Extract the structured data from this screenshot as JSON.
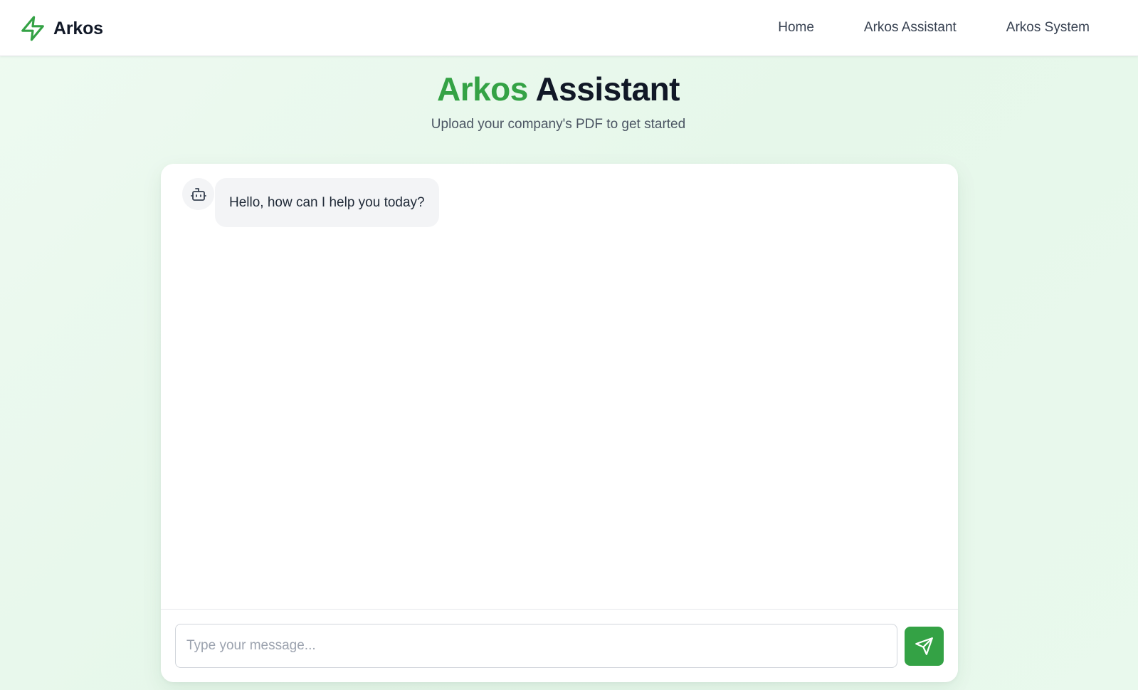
{
  "header": {
    "brand": {
      "icon": "lightning-bolt-icon",
      "name": "Arkos"
    },
    "nav": [
      {
        "label": "Home"
      },
      {
        "label": "Arkos Assistant"
      },
      {
        "label": "Arkos System"
      }
    ]
  },
  "hero": {
    "title_accent": "Arkos",
    "title_main": "Assistant",
    "subtitle": "Upload your company's PDF to get started"
  },
  "chat": {
    "messages": [
      {
        "role": "assistant",
        "avatar_icon": "bot-icon",
        "text": "Hello, how can I help you today?"
      }
    ],
    "input": {
      "placeholder": "Type your message...",
      "value": ""
    },
    "send_icon": "send-icon"
  },
  "colors": {
    "accent": "#34a245",
    "text_dark": "#111827",
    "bubble_bg": "#f3f4f6",
    "page_bg": "#e9f8ec"
  }
}
